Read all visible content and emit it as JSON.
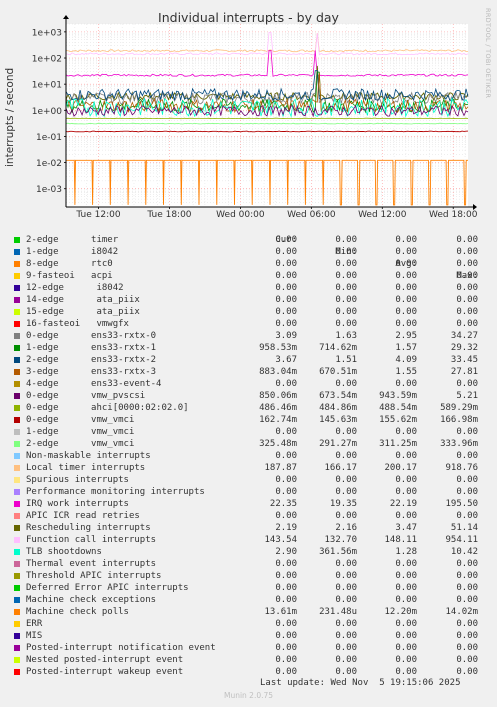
{
  "title": "Individual interrupts - by day",
  "side_label": "RRDTOOL / TOBI OETIKER",
  "footer": "Last update: Wed Nov  5 19:15:06 2025",
  "munin": "Munin 2.0.75",
  "legend_header": {
    "cur": "Cur:",
    "min": "Min:",
    "avg": "Avg:",
    "max": "Max:"
  },
  "chart_data": {
    "type": "line",
    "title": "Individual interrupts - by day",
    "ylabel": "interrupts / second",
    "yscale": "log",
    "ylim": [
      0.0002,
      2000
    ],
    "y_ticks": [
      "1e+03",
      "1e+02",
      "1e+01",
      "1e+00",
      "1e-01",
      "1e-02",
      "1e-03"
    ],
    "y_tick_values": [
      1000,
      100,
      10,
      1,
      0.1,
      0.01,
      0.001
    ],
    "x_ticks": [
      "Tue 12:00",
      "Tue 18:00",
      "Wed 00:00",
      "Wed 06:00",
      "Wed 12:00",
      "Wed 18:00"
    ],
    "x_tick_hours": [
      12,
      18,
      24,
      30,
      36,
      42
    ],
    "xlim_hours": [
      9.25,
      43.25
    ],
    "grid": true,
    "series": [
      {
        "name": "2-edge timer",
        "color": "#00cc00",
        "cur": "0.00",
        "min": "0.00",
        "avg": "0.00",
        "max": "0.00"
      },
      {
        "name": "1-edge i8042",
        "color": "#0066b3",
        "cur": "0.00",
        "min": "0.00",
        "avg": "0.00",
        "max": "0.00"
      },
      {
        "name": "8-edge rtc0",
        "color": "#ff8000",
        "cur": "0.00",
        "min": "0.00",
        "avg": "0.00",
        "max": "0.00"
      },
      {
        "name": "9-fasteoi acpi",
        "color": "#ffcc00",
        "cur": "0.00",
        "min": "0.00",
        "avg": "0.00",
        "max": "0.00"
      },
      {
        "name": "12-edge i8042",
        "color": "#330099",
        "cur": "0.00",
        "min": "0.00",
        "avg": "0.00",
        "max": "0.00"
      },
      {
        "name": "14-edge ata_piix",
        "color": "#990099",
        "cur": "0.00",
        "min": "0.00",
        "avg": "0.00",
        "max": "0.00"
      },
      {
        "name": "15-edge ata_piix",
        "color": "#ccff00",
        "cur": "0.00",
        "min": "0.00",
        "avg": "0.00",
        "max": "0.00"
      },
      {
        "name": "16-fasteoi vmwgfx",
        "color": "#ff0000",
        "cur": "0.00",
        "min": "0.00",
        "avg": "0.00",
        "max": "0.00"
      },
      {
        "name": "0-edge ens33-rxtx-0",
        "color": "#808080",
        "cur": "3.09",
        "min": "1.63",
        "avg": "2.95",
        "max": "34.27"
      },
      {
        "name": "1-edge ens33-rxtx-1",
        "color": "#008f00",
        "cur": "958.53m",
        "min": "714.62m",
        "avg": "1.57",
        "max": "29.32"
      },
      {
        "name": "2-edge ens33-rxtx-2",
        "color": "#00487d",
        "cur": "3.67",
        "min": "1.51",
        "avg": "4.09",
        "max": "33.45"
      },
      {
        "name": "3-edge ens33-rxtx-3",
        "color": "#b35a00",
        "cur": "883.04m",
        "min": "670.51m",
        "avg": "1.55",
        "max": "27.81"
      },
      {
        "name": "4-edge ens33-event-4",
        "color": "#b38f00",
        "cur": "0.00",
        "min": "0.00",
        "avg": "0.00",
        "max": "0.00"
      },
      {
        "name": "0-edge vmw_pvscsi",
        "color": "#6b006b",
        "cur": "850.06m",
        "min": "673.54m",
        "avg": "943.59m",
        "max": "5.21"
      },
      {
        "name": "0-edge ahci[0000:02:02.0]",
        "color": "#8fb300",
        "cur": "486.46m",
        "min": "484.86m",
        "avg": "488.54m",
        "max": "589.29m"
      },
      {
        "name": "0-edge vmw_vmci",
        "color": "#b30000",
        "cur": "162.74m",
        "min": "145.63m",
        "avg": "155.62m",
        "max": "166.98m"
      },
      {
        "name": "1-edge vmw_vmci",
        "color": "#bebebe",
        "cur": "0.00",
        "min": "0.00",
        "avg": "0.00",
        "max": "0.00"
      },
      {
        "name": "2-edge vmw_vmci",
        "color": "#80ff80",
        "cur": "325.48m",
        "min": "291.27m",
        "avg": "311.25m",
        "max": "333.96m"
      },
      {
        "name": "Non-maskable interrupts",
        "color": "#80c9ff",
        "cur": "0.00",
        "min": "0.00",
        "avg": "0.00",
        "max": "0.00"
      },
      {
        "name": "Local timer interrupts",
        "color": "#ffc080",
        "cur": "187.87",
        "min": "166.17",
        "avg": "200.17",
        "max": "918.76"
      },
      {
        "name": "Spurious interrupts",
        "color": "#ffe680",
        "cur": "0.00",
        "min": "0.00",
        "avg": "0.00",
        "max": "0.00"
      },
      {
        "name": "Performance monitoring interrupts",
        "color": "#aa80ff",
        "cur": "0.00",
        "min": "0.00",
        "avg": "0.00",
        "max": "0.00"
      },
      {
        "name": "IRQ work interrupts",
        "color": "#ee00cc",
        "cur": "22.35",
        "min": "19.35",
        "avg": "22.19",
        "max": "195.50"
      },
      {
        "name": "APIC ICR read retries",
        "color": "#ff8080",
        "cur": "0.00",
        "min": "0.00",
        "avg": "0.00",
        "max": "0.00"
      },
      {
        "name": "Rescheduling interrupts",
        "color": "#666600",
        "cur": "2.19",
        "min": "2.16",
        "avg": "3.47",
        "max": "51.14"
      },
      {
        "name": "Function call interrupts",
        "color": "#ffbfff",
        "cur": "143.54",
        "min": "132.70",
        "avg": "148.11",
        "max": "954.11"
      },
      {
        "name": "TLB shootdowns",
        "color": "#00ffcc",
        "cur": "2.90",
        "min": "361.56m",
        "avg": "1.28",
        "max": "10.42"
      },
      {
        "name": "Thermal event interrupts",
        "color": "#cc6699",
        "cur": "0.00",
        "min": "0.00",
        "avg": "0.00",
        "max": "0.00"
      },
      {
        "name": "Threshold APIC interrupts",
        "color": "#999900",
        "cur": "0.00",
        "min": "0.00",
        "avg": "0.00",
        "max": "0.00"
      },
      {
        "name": "Deferred Error APIC interrupts",
        "color": "#00cc00",
        "cur": "0.00",
        "min": "0.00",
        "avg": "0.00",
        "max": "0.00"
      },
      {
        "name": "Machine check exceptions",
        "color": "#0066b3",
        "cur": "0.00",
        "min": "0.00",
        "avg": "0.00",
        "max": "0.00"
      },
      {
        "name": "Machine check polls",
        "color": "#ff8000",
        "cur": "13.61m",
        "min": "231.48u",
        "avg": "12.20m",
        "max": "14.02m"
      },
      {
        "name": "ERR",
        "color": "#ffcc00",
        "cur": "0.00",
        "min": "0.00",
        "avg": "0.00",
        "max": "0.00"
      },
      {
        "name": "MIS",
        "color": "#330099",
        "cur": "0.00",
        "min": "0.00",
        "avg": "0.00",
        "max": "0.00"
      },
      {
        "name": "Posted-interrupt notification event",
        "color": "#990099",
        "cur": "0.00",
        "min": "0.00",
        "avg": "0.00",
        "max": "0.00"
      },
      {
        "name": "Nested posted-interrupt event",
        "color": "#ccff00",
        "cur": "0.00",
        "min": "0.00",
        "avg": "0.00",
        "max": "0.00"
      },
      {
        "name": "Posted-interrupt wakeup event",
        "color": "#ff0000",
        "cur": "0.00",
        "min": "0.00",
        "avg": "0.00",
        "max": "0.00"
      }
    ]
  }
}
